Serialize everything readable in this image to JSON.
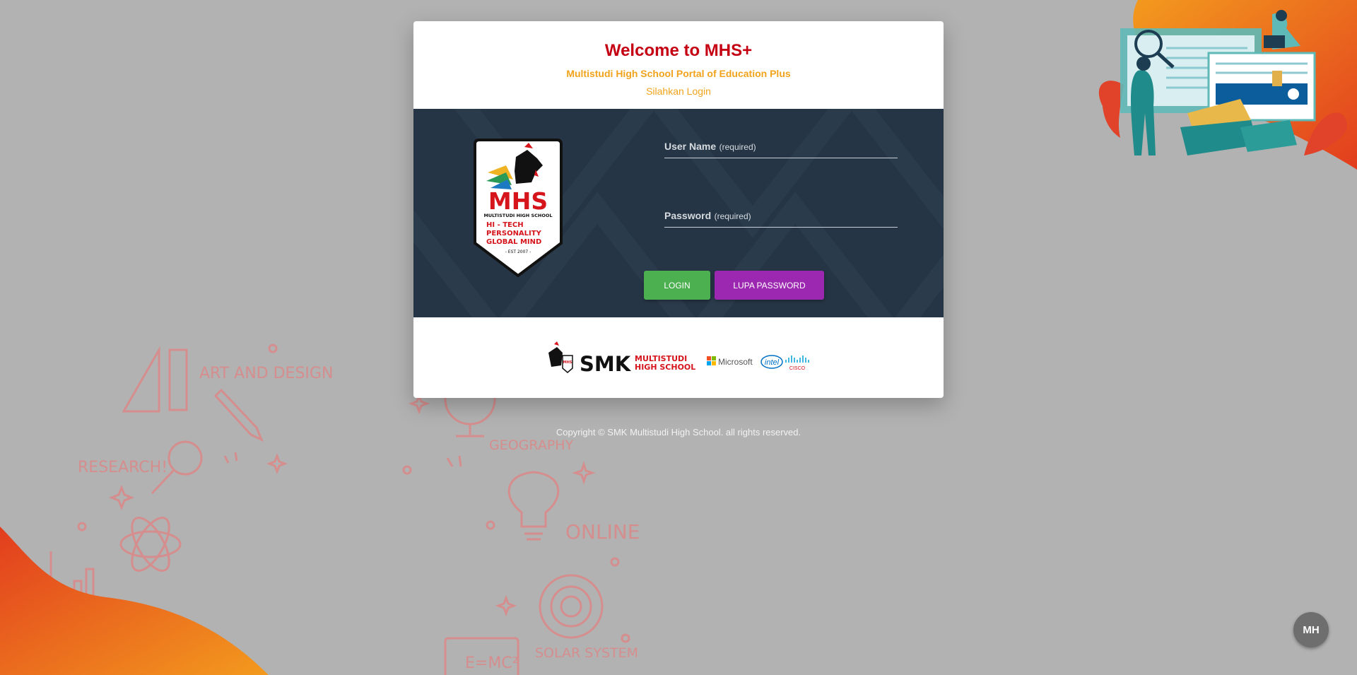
{
  "card": {
    "welcome": "Welcome to MHS+",
    "subtitle": "Multistudi High School Portal of Education Plus",
    "instruction": "Silahkan Login"
  },
  "logo": {
    "brand": "MHS",
    "school": "MULTISTUDI HIGH SCHOOL",
    "tagline_1": "HI - TECH",
    "tagline_2": "PERSONALITY",
    "tagline_3": "GLOBAL  MIND",
    "established": "- EST 2007 -"
  },
  "form": {
    "username_label": "User Name",
    "username_required": "(required)",
    "password_label": "Password",
    "password_required": "(required)",
    "login_button": "LOGIN",
    "forgot_button": "LUPA PASSWORD"
  },
  "partners": {
    "smk": "SMK",
    "multistudi_1": "MULTISTUDI",
    "multistudi_2": "HIGH SCHOOL",
    "microsoft": "Microsoft",
    "intel": "intel",
    "cisco": "CISCO"
  },
  "background": {
    "art_and_design": "ART AND DESIGN",
    "research": "RESEARCH!",
    "geography": "GEOGRAPHY",
    "online": "ONLINE",
    "solar_system": "SOLAR SYSTEM",
    "emc2": "E=MC²"
  },
  "footer": {
    "copyright": "Copyright © SMK Multistudi High School. all rights reserved."
  },
  "user": {
    "initials": "MH"
  },
  "colors": {
    "background": "#b2b2b2",
    "title_red": "#c40012",
    "subtitle_orange": "#f0a31b",
    "panel_navy": "#263545",
    "login_green": "#4caf50",
    "forgot_purple": "#9c27b0",
    "doodle_pink": "#d98a8a"
  }
}
